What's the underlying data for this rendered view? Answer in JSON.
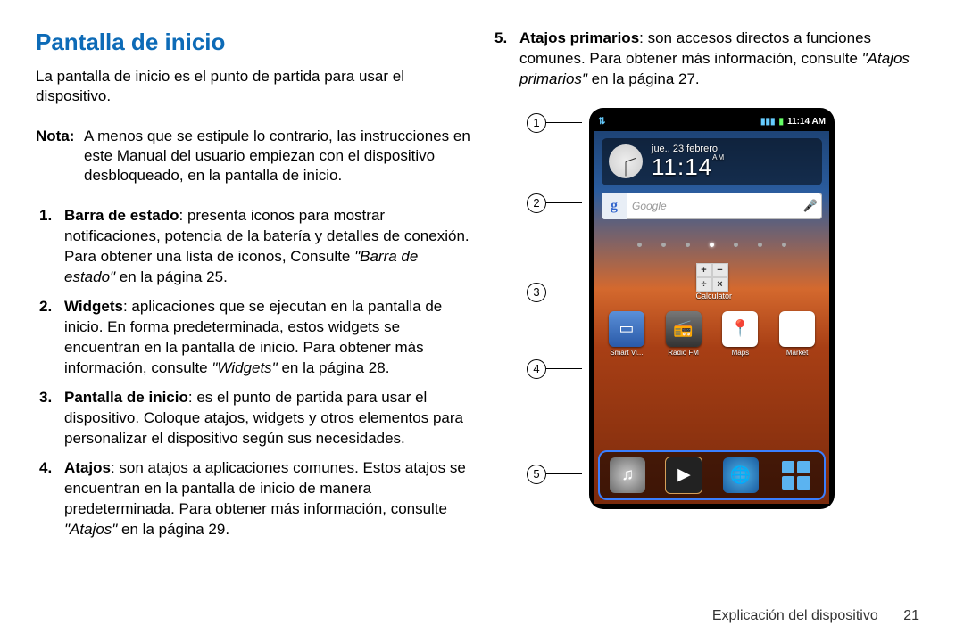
{
  "title": "Pantalla de inicio",
  "intro": "La pantalla de inicio es el punto de partida para usar el dispositivo.",
  "note_label": "Nota:",
  "note_body": "A menos que se estipule lo contrario, las instrucciones en este Manual del usuario empiezan con el dispositivo desbloqueado, en la pantalla de inicio.",
  "items": [
    {
      "term": "Barra de estado",
      "desc": ": presenta iconos para mostrar notificaciones, potencia de la batería y detalles de conexión. Para obtener una lista de iconos, Consulte ",
      "ref": "\"Barra de estado\"",
      "ref_tail": " en la página 25."
    },
    {
      "term": "Widgets",
      "desc": ": aplicaciones que se ejecutan en la pantalla de inicio. En forma predeterminada, estos widgets se encuentran en la pantalla de inicio. Para obtener más información, consulte ",
      "ref": "\"Widgets\"",
      "ref_tail": " en la página 28."
    },
    {
      "term": "Pantalla de inicio",
      "desc": ": es el punto de partida para usar el dispositivo. Coloque atajos, widgets y otros elementos para personalizar el dispositivo según sus necesidades.",
      "ref": "",
      "ref_tail": ""
    },
    {
      "term": "Atajos",
      "desc": ": son atajos a aplicaciones comunes. Estos atajos se encuentran en la pantalla de inicio de manera predeterminada. Para obtener más información, consulte ",
      "ref": "\"Atajos\"",
      "ref_tail": " en la página 29."
    },
    {
      "term": "Atajos primarios",
      "desc": ": son accesos directos a funciones comunes. Para obtener más información, consulte ",
      "ref": "\"Atajos primarios\"",
      "ref_tail": " en la página 27."
    }
  ],
  "callouts": [
    "1",
    "2",
    "3",
    "4",
    "5"
  ],
  "phone": {
    "status_time": "11:14 AM",
    "clock_date": "jue., 23 febrero",
    "clock_time": "11:14",
    "clock_ampm": "AM",
    "search_placeholder": "Google",
    "calc_label": "Calculator",
    "apps": [
      {
        "label": "Smart Vi..."
      },
      {
        "label": "Radio FM"
      },
      {
        "label": "Maps"
      },
      {
        "label": "Market"
      }
    ]
  },
  "footer_section": "Explicación del dispositivo",
  "footer_page": "21"
}
